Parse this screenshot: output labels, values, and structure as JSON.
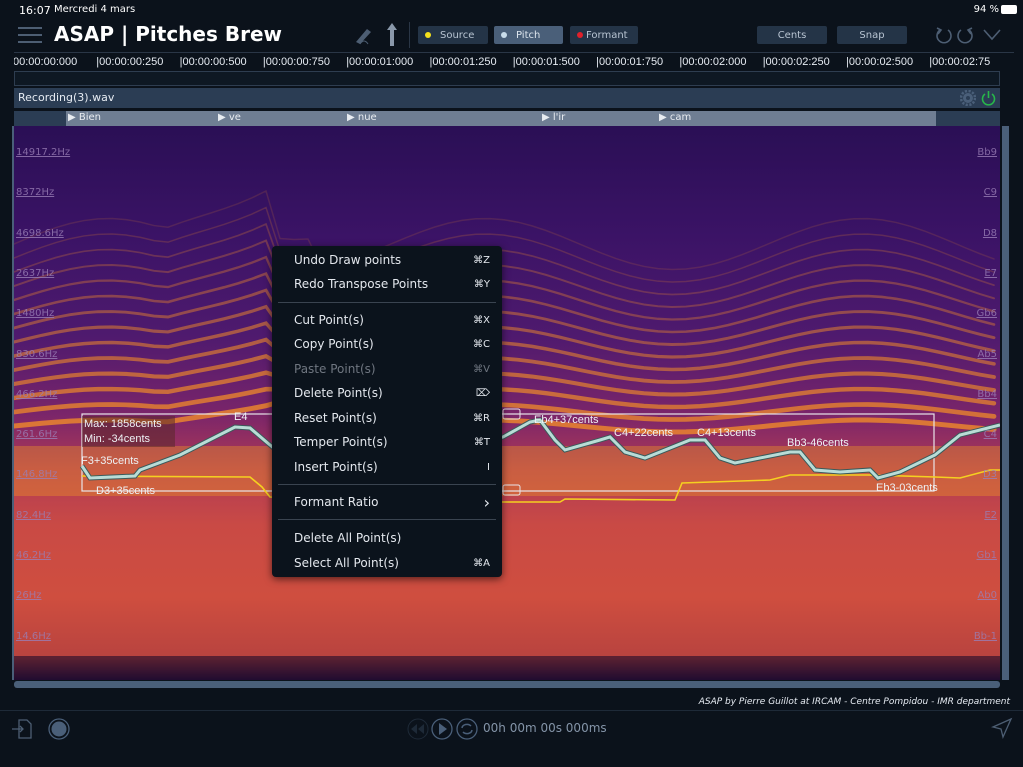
{
  "status": {
    "time": "16:07",
    "date": "Mercredi 4 mars",
    "battery": "94 %"
  },
  "header": {
    "title": "ASAP | Pitches Brew",
    "modes": [
      {
        "label": "Source",
        "color": "#f5e11b",
        "active": false
      },
      {
        "label": "Pitch",
        "color": "#c9dcea",
        "active": true
      },
      {
        "label": "Formant",
        "color": "#e0202a",
        "active": false
      }
    ],
    "cents_label": "Cents",
    "snap_label": "Snap"
  },
  "timeline": [
    "00:00:00:000",
    "|00:00:00:250",
    "|00:00:00:500",
    "|00:00:00:750",
    "|00:00:01:000",
    "|00:00:01:250",
    "|00:00:01:500",
    "|00:00:01:750",
    "|00:00:02:000",
    "|00:00:02:250",
    "|00:00:02:500",
    "|00:00:02:75"
  ],
  "track": {
    "name": "Recording(3).wav",
    "lyrics": [
      "Bien",
      "ve",
      "nue",
      "l'ir",
      "cam"
    ],
    "freq_labels": [
      "14917.2Hz",
      "8372Hz",
      "4698.6Hz",
      "2637Hz",
      "1480Hz",
      "830.6Hz",
      "466.2Hz",
      "261.6Hz",
      "146.8Hz",
      "82.4Hz",
      "46.2Hz",
      "26Hz",
      "14.6Hz"
    ],
    "note_labels": [
      "Bb9",
      "C9",
      "D8",
      "E7",
      "Gb6",
      "Ab5",
      "Bb4",
      "C4",
      "D3",
      "E2",
      "Gb1",
      "Ab0",
      "Bb-1"
    ]
  },
  "selection": {
    "max": "Max: 1858cents",
    "min": "Min: -34cents",
    "annotations": [
      "F3+35cents",
      "D3+35cents",
      "E4",
      "Eb4+37cents",
      "C4+22cents",
      "C4+13cents",
      "Bb3-46cents",
      "Eb3-03cents"
    ]
  },
  "context_menu": {
    "items": [
      {
        "label": "Undo Draw points",
        "shortcut": "⌘Z",
        "enabled": true
      },
      {
        "label": "Redo Transpose Points",
        "shortcut": "⌘Y",
        "enabled": true
      },
      {
        "label": "Cut Point(s)",
        "shortcut": "⌘X",
        "enabled": true
      },
      {
        "label": "Copy Point(s)",
        "shortcut": "⌘C",
        "enabled": true
      },
      {
        "label": "Paste Point(s)",
        "shortcut": "⌘V",
        "enabled": false
      },
      {
        "label": "Delete Point(s)",
        "shortcut": "⌦",
        "enabled": true
      },
      {
        "label": "Reset Point(s)",
        "shortcut": "⌘R",
        "enabled": true
      },
      {
        "label": "Temper Point(s)",
        "shortcut": "⌘T",
        "enabled": true
      },
      {
        "label": "Insert Point(s)",
        "shortcut": "I",
        "enabled": true
      },
      {
        "label": "Formant Ratio",
        "shortcut": "›",
        "enabled": true
      },
      {
        "label": "Delete All Point(s)",
        "shortcut": "",
        "enabled": true
      },
      {
        "label": "Select All Point(s)",
        "shortcut": "⌘A",
        "enabled": true
      }
    ]
  },
  "footer": {
    "credit": "ASAP by Pierre Guillot at IRCAM - Centre Pompidou - IMR department",
    "time": "00h 00m 00s 000ms"
  },
  "colors": {
    "pitch_curve": "#b9dcd6",
    "source_curve": "#f5d020",
    "accent": "#4a5f79"
  }
}
